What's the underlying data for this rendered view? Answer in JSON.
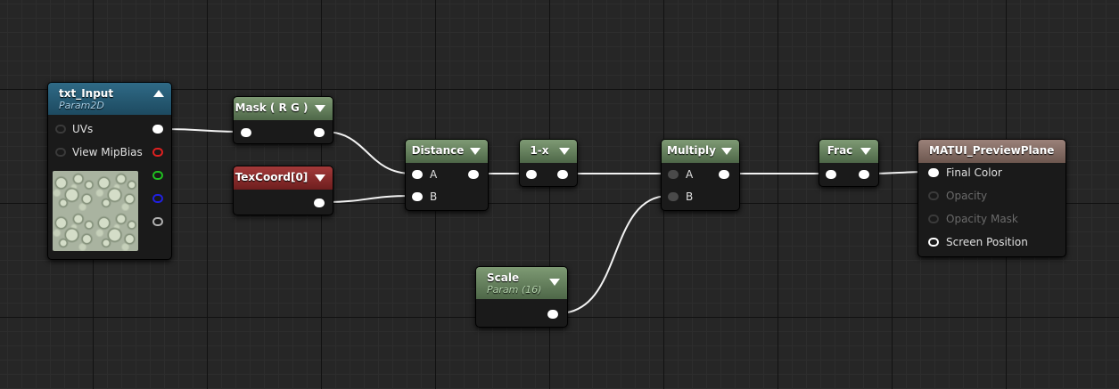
{
  "nodes": {
    "txt_input": {
      "title": "txt_Input",
      "subtitle": "Param2D",
      "inputs": [
        "UVs",
        "View MipBias"
      ]
    },
    "mask": {
      "title": "Mask ( R G )"
    },
    "texcoord": {
      "title": "TexCoord[0]"
    },
    "distance": {
      "title": "Distance",
      "inputs": [
        "A",
        "B"
      ]
    },
    "one_minus_x": {
      "title": "1-x"
    },
    "multiply": {
      "title": "Multiply",
      "inputs": [
        "A",
        "B"
      ]
    },
    "scale": {
      "title": "Scale",
      "subtitle": "Param (16)"
    },
    "frac": {
      "title": "Frac"
    },
    "preview_plane": {
      "title": "MATUI_PreviewPlane",
      "inputs": [
        "Final Color",
        "Opacity",
        "Opacity Mask",
        "Screen Position"
      ]
    }
  },
  "icons": {
    "collapse": "chevron-up-icon",
    "expand": "chevron-down-icon",
    "pin": "exec-pin-icon"
  },
  "colors": {
    "background": "#262626",
    "node_body": "#1a1a1a",
    "header_green": "#5f7a58",
    "header_red": "#8a2a2a",
    "header_teal": "#245870",
    "header_brown": "#806660",
    "wire": "#ffffff",
    "pin_red": "#e02020",
    "pin_green": "#20c020",
    "pin_blue": "#2020e0"
  }
}
